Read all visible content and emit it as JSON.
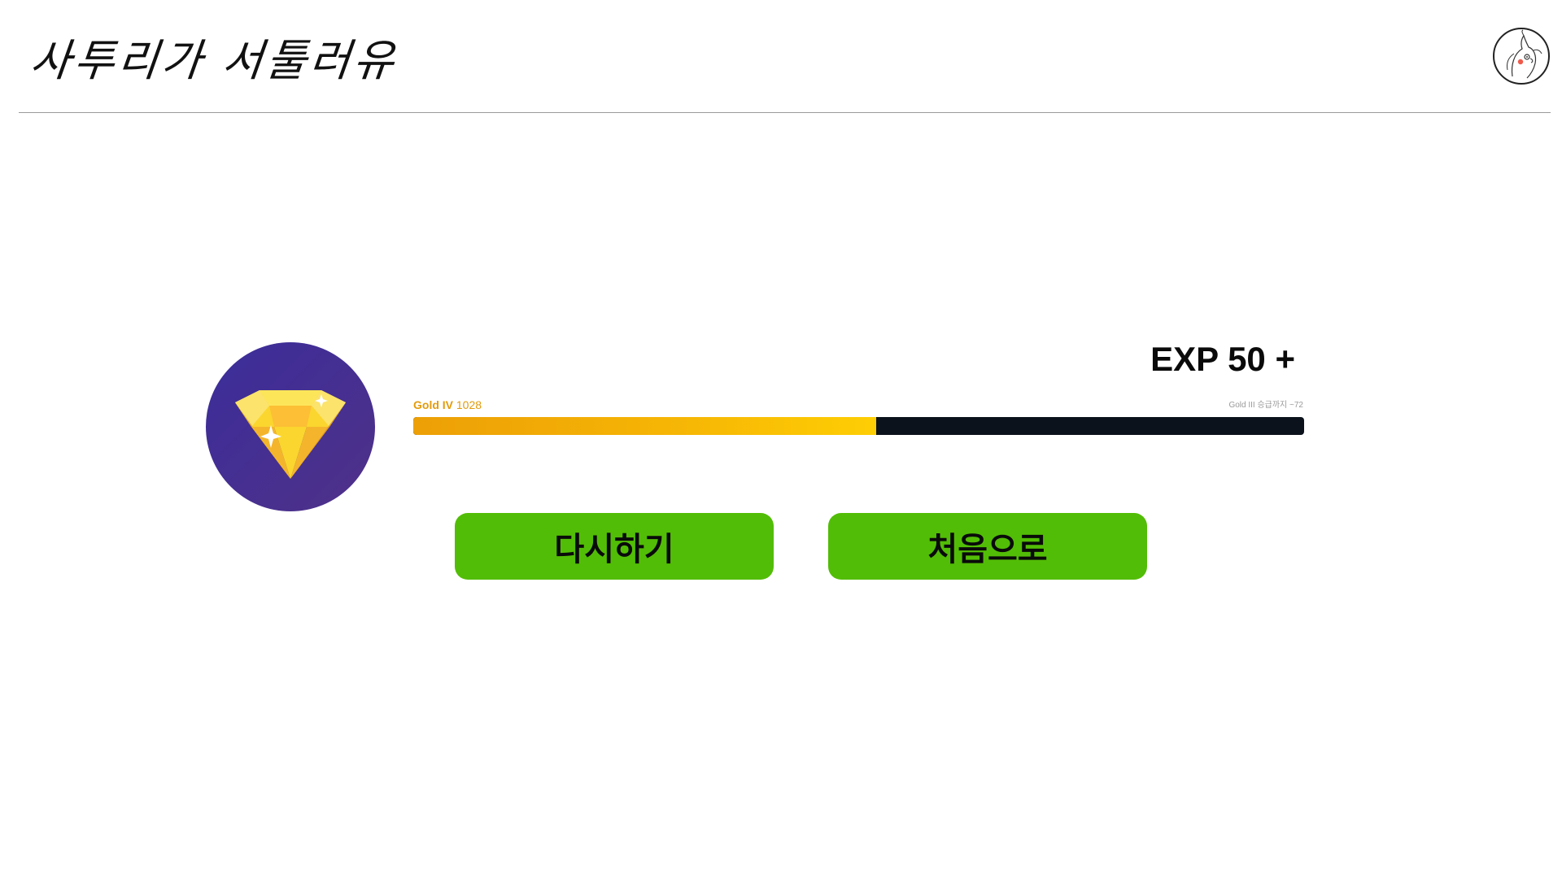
{
  "header": {
    "logo_text": "사투리가 서툴러유",
    "avatar_icon": "bird-avatar-icon"
  },
  "result": {
    "badge_icon": "gold-diamond-icon",
    "exp_label": "EXP 50 +",
    "tier_name": "Gold IV",
    "tier_points": "1028",
    "next_tier_text": "Gold III 승급까지 ~72",
    "progress": 0.52
  },
  "actions": {
    "retry_label": "다시하기",
    "home_label": "처음으로"
  },
  "colors": {
    "badge_bg": "#45308c",
    "gem_gold": "#fbd62e",
    "bar_track": "#0c121b",
    "bar_fill": "#f7b705",
    "button_green": "#52bd06",
    "tier_text": "#e39b0b"
  }
}
